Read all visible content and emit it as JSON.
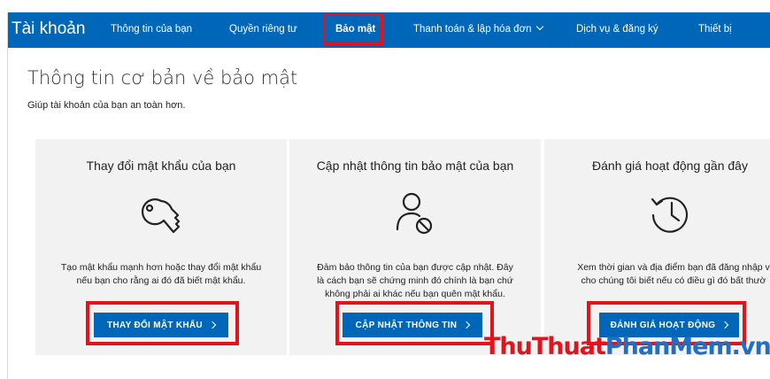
{
  "nav": {
    "brand": "Tài khoản",
    "items": [
      {
        "label": "Thông tin của bạn"
      },
      {
        "label": "Quyền riêng tư"
      },
      {
        "label": "Bảo mật"
      },
      {
        "label": "Thanh toán & lập hóa đơn"
      },
      {
        "label": "Dịch vụ & đăng ký"
      },
      {
        "label": "Thiết bị"
      }
    ],
    "active_index": 2
  },
  "page": {
    "title": "Thông tin cơ bản về bảo mật",
    "subtitle": "Giúp tài khoản của bạn an toàn hơn."
  },
  "cards": [
    {
      "title": "Thay đổi mật khẩu của bạn",
      "icon": "key-icon",
      "desc1": "Tạo mật khẩu mạnh hơn hoặc thay đổi mật khẩu",
      "desc2": "nếu bạn cho rằng ai đó đã biết mật khẩu.",
      "desc3": "",
      "button": "THAY ĐỔI MẬT KHẨU"
    },
    {
      "title": "Cập nhật thông tin bảo mật của bạn",
      "icon": "user-block-icon",
      "desc1": "Đảm bảo thông tin của bạn được cập nhật. Đây",
      "desc2": "là cách bạn sẽ chứng minh đó chính là bạn chứ",
      "desc3": "không phải ai khác nếu bạn quên mật khẩu.",
      "button": "CẬP NHẬT THÔNG TIN"
    },
    {
      "title": "Đánh giá hoạt động gần đây",
      "icon": "history-icon",
      "desc1": "Xem thời gian và địa điểm bạn đã đăng nhập v",
      "desc2": "cho chúng tôi biết nếu có điều gì đó bất thườ",
      "desc3": "",
      "button": "ĐÁNH GIÁ HOẠT ĐỘNG"
    }
  ],
  "watermark": {
    "part1": "ThuThuat",
    "part2": "PhanMem",
    "part3": ".vn"
  },
  "colors": {
    "nav": "#0067b8",
    "highlight": "#e3131c",
    "card": "#f2f2f2"
  }
}
